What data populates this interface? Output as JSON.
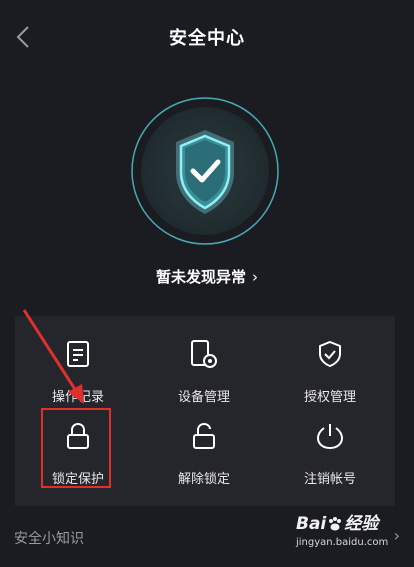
{
  "header": {
    "title": "安全中心"
  },
  "status": {
    "text": "暂未发现异常",
    "chevron": "›"
  },
  "grid": {
    "items": [
      {
        "label": "操作记录",
        "icon": "document-icon"
      },
      {
        "label": "设备管理",
        "icon": "device-gear-icon"
      },
      {
        "label": "授权管理",
        "icon": "shield-check-icon"
      },
      {
        "label": "锁定保护",
        "icon": "lock-icon"
      },
      {
        "label": "解除锁定",
        "icon": "unlock-icon"
      },
      {
        "label": "注销帐号",
        "icon": "power-icon"
      }
    ]
  },
  "tips": {
    "title": "安全小知识",
    "more": "›"
  },
  "watermark": {
    "logo_left": "Bai",
    "logo_right": "经验",
    "url": "jingyan.baidu.com"
  },
  "colors": {
    "background": "#1b1c22",
    "card": "#25262c",
    "accent": "#5fd3e0",
    "highlight": "#e0302e"
  }
}
